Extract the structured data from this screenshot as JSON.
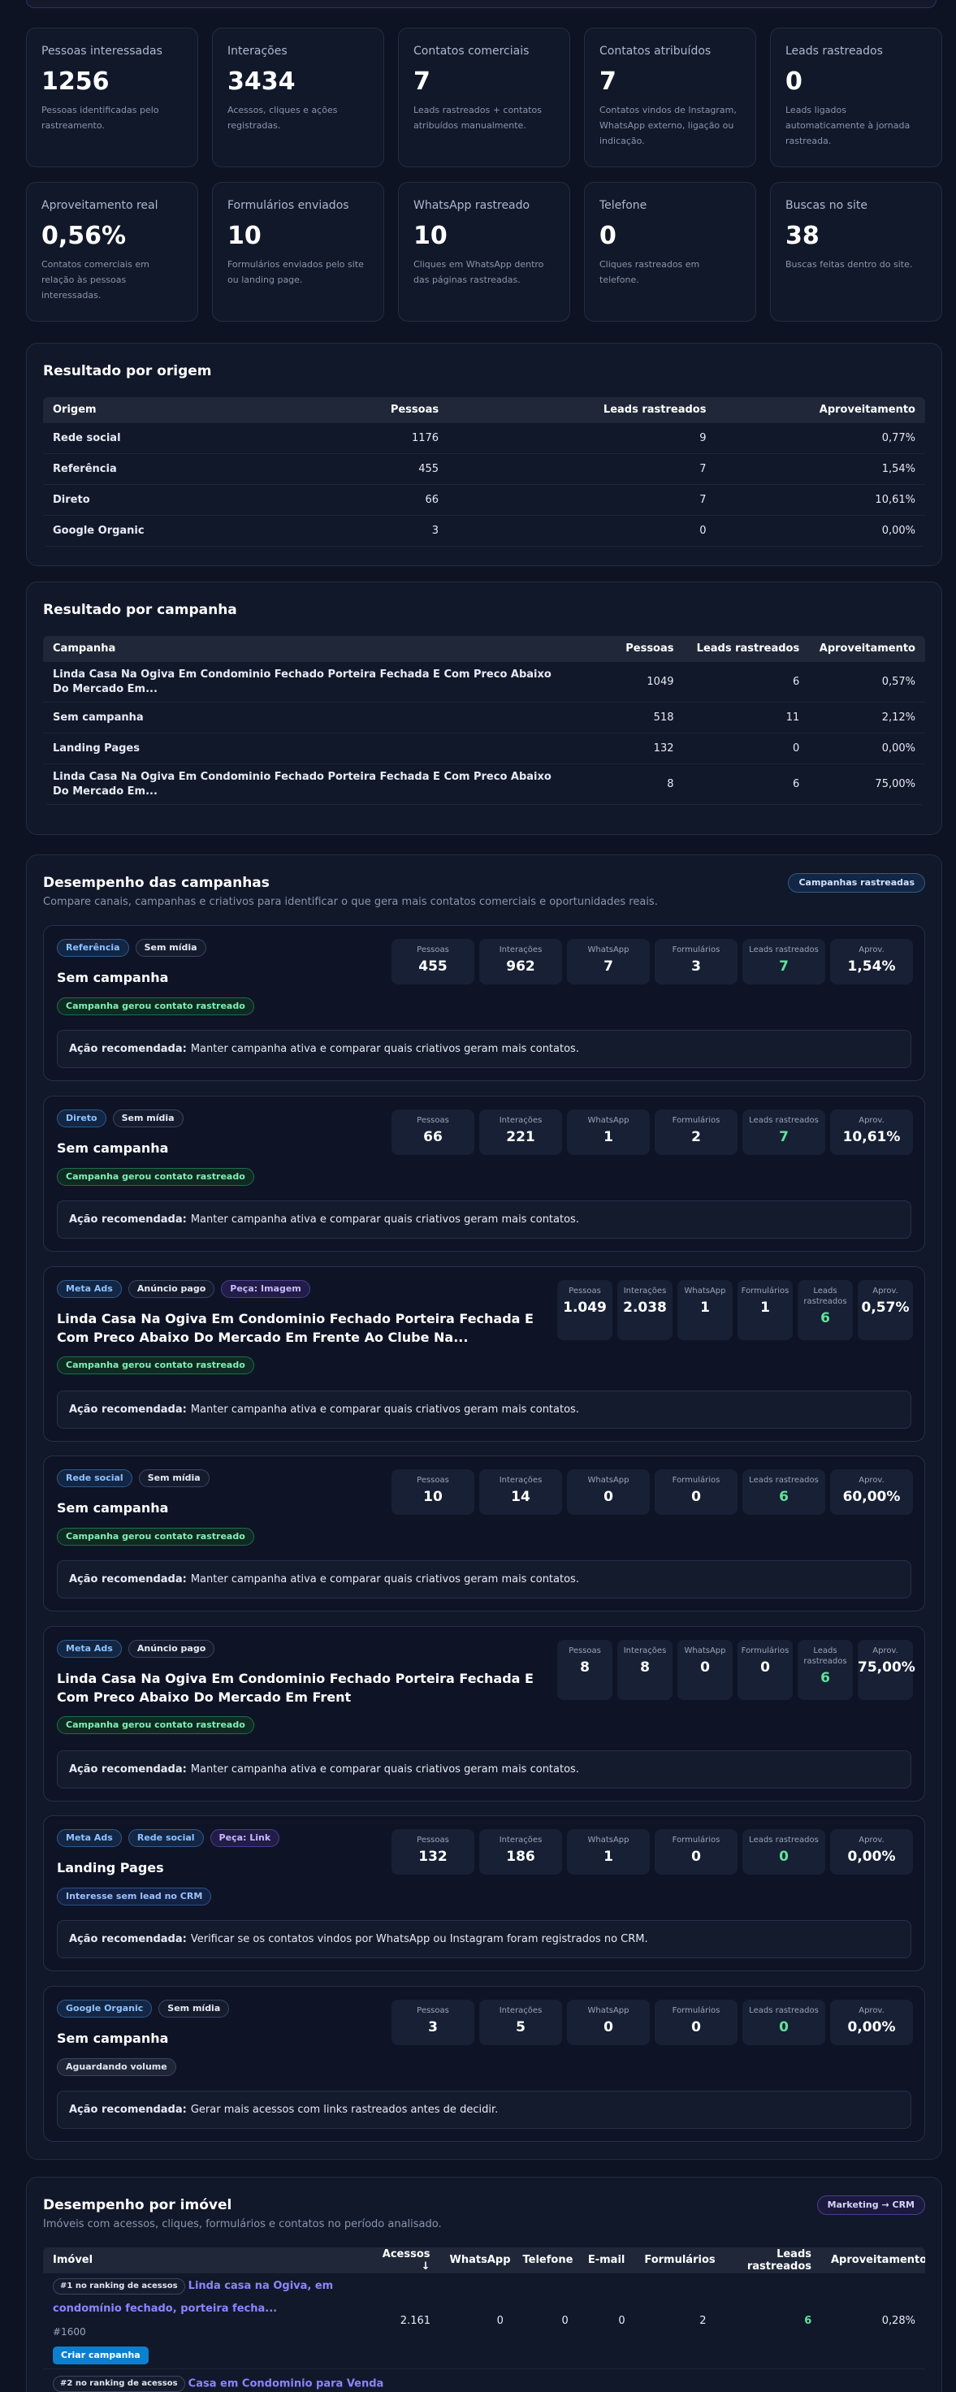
{
  "kpis": [
    {
      "label": "Pessoas interessadas",
      "value": "1256",
      "desc": "Pessoas identificadas pelo rastreamento."
    },
    {
      "label": "Interações",
      "value": "3434",
      "desc": "Acessos, cliques e ações registradas."
    },
    {
      "label": "Contatos comerciais",
      "value": "7",
      "desc": "Leads rastreados + contatos atribuídos manualmente."
    },
    {
      "label": "Contatos atribuídos",
      "value": "7",
      "desc": "Contatos vindos de Instagram, WhatsApp externo, ligação ou indicação."
    },
    {
      "label": "Leads rastreados",
      "value": "0",
      "desc": "Leads ligados automaticamente à jornada rastreada."
    },
    {
      "label": "Aproveitamento real",
      "value": "0,56%",
      "desc": "Contatos comerciais em relação às pessoas interessadas."
    },
    {
      "label": "Formulários enviados",
      "value": "10",
      "desc": "Formulários enviados pelo site ou landing page."
    },
    {
      "label": "WhatsApp rastreado",
      "value": "10",
      "desc": "Cliques em WhatsApp dentro das páginas rastreadas."
    },
    {
      "label": "Telefone",
      "value": "0",
      "desc": "Cliques rastreados em telefone."
    },
    {
      "label": "Buscas no site",
      "value": "38",
      "desc": "Buscas feitas dentro do site."
    }
  ],
  "origem": {
    "title": "Resultado por origem",
    "headers": [
      "Origem",
      "Pessoas",
      "Leads rastreados",
      "Aproveitamento"
    ],
    "rows": [
      [
        "Rede social",
        "1176",
        "9",
        "0,77%"
      ],
      [
        "Referência",
        "455",
        "7",
        "1,54%"
      ],
      [
        "Direto",
        "66",
        "7",
        "10,61%"
      ],
      [
        "Google Organic",
        "3",
        "0",
        "0,00%"
      ]
    ]
  },
  "campanha": {
    "title": "Resultado por campanha",
    "headers": [
      "Campanha",
      "Pessoas",
      "Leads rastreados",
      "Aproveitamento"
    ],
    "rows": [
      [
        "Linda Casa Na Ogiva Em Condominio Fechado Porteira Fechada E Com Preco Abaixo Do Mercado Em...",
        "1049",
        "6",
        "0,57%"
      ],
      [
        "Sem campanha",
        "518",
        "11",
        "2,12%"
      ],
      [
        "Landing Pages",
        "132",
        "0",
        "0,00%"
      ],
      [
        "Linda Casa Na Ogiva Em Condominio Fechado Porteira Fechada E Com Preco Abaixo Do Mercado Em...",
        "8",
        "6",
        "75,00%"
      ]
    ]
  },
  "desempenho": {
    "title": "Desempenho das campanhas",
    "subtitle": "Compare canais, campanhas e criativos para identificar o que gera mais contatos comerciais e oportunidades reais.",
    "chip": "Campanhas rastreadas",
    "rec_label": "Ação recomendada:",
    "metric_labels": [
      "Pessoas",
      "Interações",
      "WhatsApp",
      "Formulários",
      "Leads rastreados",
      "Aprov."
    ],
    "cards": [
      {
        "tags": [
          "Referência",
          "Sem mídia"
        ],
        "title": "Sem campanha",
        "status": "Campanha gerou contato rastreado",
        "metrics": [
          "455",
          "962",
          "7",
          "3",
          "7",
          "1,54%"
        ],
        "rec": "Manter campanha ativa e comparar quais criativos geram mais contatos."
      },
      {
        "tags": [
          "Direto",
          "Sem mídia"
        ],
        "title": "Sem campanha",
        "status": "Campanha gerou contato rastreado",
        "metrics": [
          "66",
          "221",
          "1",
          "2",
          "7",
          "10,61%"
        ],
        "rec": "Manter campanha ativa e comparar quais criativos geram mais contatos."
      },
      {
        "tags": [
          "Meta Ads",
          "Anúncio pago",
          "Peça: Imagem"
        ],
        "title": "Linda Casa Na Ogiva Em Condominio Fechado Porteira Fechada E Com Preco Abaixo Do Mercado Em Frente Ao Clube Na...",
        "status": "Campanha gerou contato rastreado",
        "metrics": [
          "1.049",
          "2.038",
          "1",
          "1",
          "6",
          "0,57%"
        ],
        "rec": "Manter campanha ativa e comparar quais criativos geram mais contatos."
      },
      {
        "tags": [
          "Rede social",
          "Sem mídia"
        ],
        "title": "Sem campanha",
        "status": "Campanha gerou contato rastreado",
        "metrics": [
          "10",
          "14",
          "0",
          "0",
          "6",
          "60,00%"
        ],
        "rec": "Manter campanha ativa e comparar quais criativos geram mais contatos."
      },
      {
        "tags": [
          "Meta Ads",
          "Anúncio pago"
        ],
        "title": "Linda Casa Na Ogiva Em Condominio Fechado Porteira Fechada E Com Preco Abaixo Do Mercado Em Frent",
        "status": "Campanha gerou contato rastreado",
        "metrics": [
          "8",
          "8",
          "0",
          "0",
          "6",
          "75,00%"
        ],
        "rec": "Manter campanha ativa e comparar quais criativos geram mais contatos."
      },
      {
        "tags": [
          "Meta Ads",
          "Rede social",
          "Peça: Link"
        ],
        "title": "Landing Pages",
        "status": "Interesse sem lead no CRM",
        "metrics": [
          "132",
          "186",
          "1",
          "0",
          "0",
          "0,00%"
        ],
        "rec": "Verificar se os contatos vindos por WhatsApp ou Instagram foram registrados no CRM."
      },
      {
        "tags": [
          "Google Organic",
          "Sem mídia"
        ],
        "title": "Sem campanha",
        "status": "Aguardando volume",
        "metrics": [
          "3",
          "5",
          "0",
          "0",
          "0",
          "0,00%"
        ],
        "rec": "Gerar mais acessos com links rastreados antes de decidir."
      }
    ]
  },
  "imovel": {
    "title": "Desempenho por imóvel",
    "subtitle": "Imóveis com acessos, cliques, formulários e contatos no período analisado.",
    "chip": "Marketing → CRM",
    "headers": [
      "Imóvel",
      "Acessos ↓",
      "WhatsApp",
      "Telefone",
      "E-mail",
      "Formulários",
      "Leads rastreados",
      "Aproveitamento"
    ],
    "row1": {
      "rank": "#1 no ranking de acessos",
      "name": "Linda casa na Ogiva, em condomínio fechado, porteira fecha...",
      "code": "#1600",
      "button": "Criar campanha",
      "values": [
        "2.161",
        "0",
        "0",
        "0",
        "2",
        "6",
        "0,28%"
      ]
    },
    "row2": {
      "rank": "#2 no ranking de acessos",
      "name": "Casa em Condominio para Venda"
    }
  }
}
